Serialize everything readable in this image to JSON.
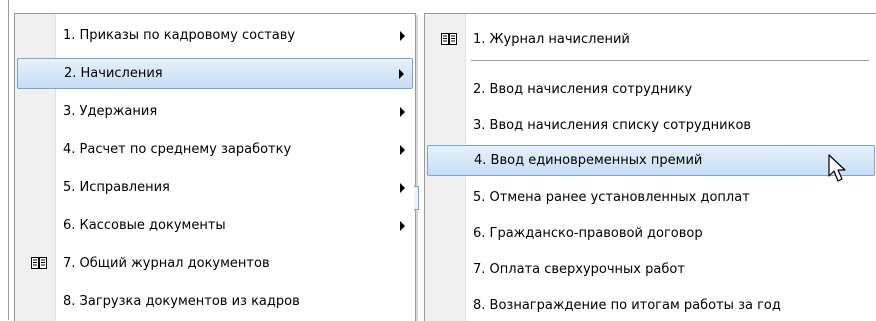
{
  "menu_main": {
    "items": [
      {
        "label": "1. Приказы по кадровому составу",
        "submenu": true
      },
      {
        "label": "2. Начисления",
        "submenu": true,
        "highlighted": true
      },
      {
        "label": "3. Удержания",
        "submenu": true
      },
      {
        "label": "4. Расчет по среднему заработку",
        "submenu": true
      },
      {
        "label": "5. Исправления",
        "submenu": true
      },
      {
        "label": "6. Кассовые документы",
        "submenu": true
      },
      {
        "label": "7. Общий журнал документов",
        "icon": "book-icon"
      },
      {
        "label": "8. Загрузка документов из кадров"
      }
    ]
  },
  "menu_sub": {
    "items": [
      {
        "label": "1. Журнал начислений",
        "icon": "book-icon"
      },
      {
        "label": "2. Ввод начисления сотруднику"
      },
      {
        "label": "3. Ввод начисления списку сотрудников"
      },
      {
        "label": "4. Ввод единовременных премий",
        "highlighted": true
      },
      {
        "label": "5. Отмена ранее установленных доплат"
      },
      {
        "label": "6. Гражданско-правовой договор"
      },
      {
        "label": "7. Оплата сверхурочных работ"
      },
      {
        "label": "8. Вознаграждение по итогам работы за год"
      }
    ]
  },
  "colors": {
    "highlight_border": "#7da2ce",
    "highlight_fill": "#c6ddf5",
    "gutter": "#f0f0f0"
  }
}
